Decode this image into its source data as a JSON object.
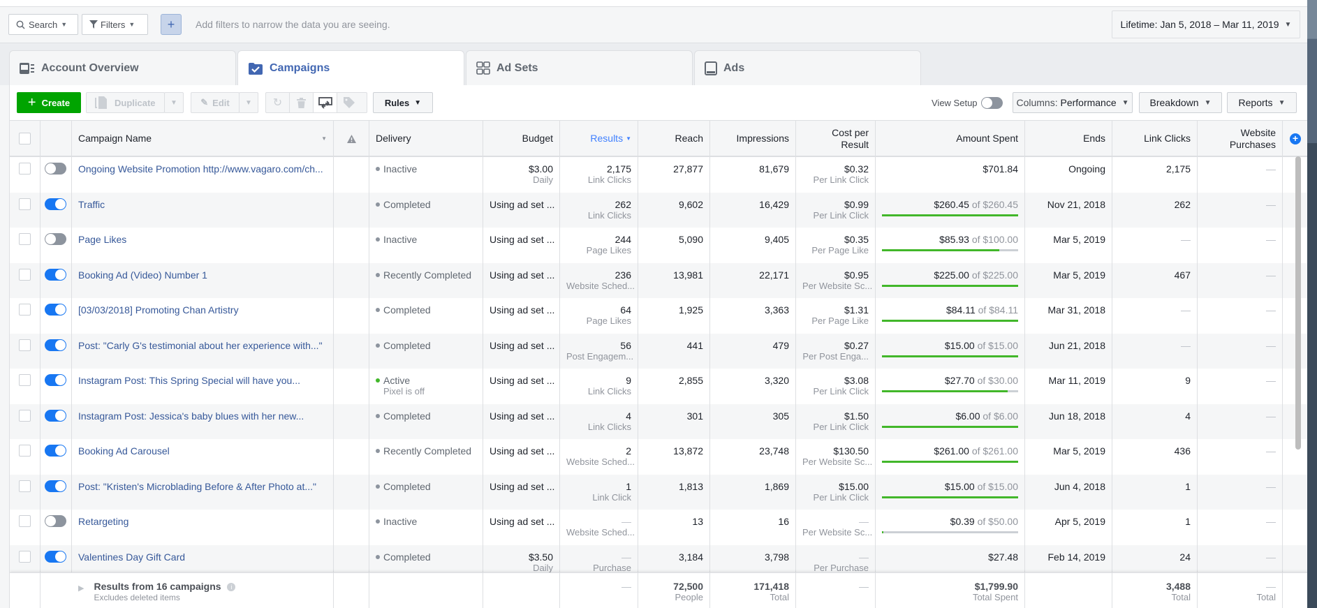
{
  "filterbar": {
    "search_label": "Search",
    "filters_label": "Filters",
    "add_filter_icon": "plus-icon",
    "hint": "Add filters to narrow the data you are seeing.",
    "date_range": "Lifetime: Jan 5, 2018 – Mar 11, 2019"
  },
  "tabs": [
    {
      "label": "Account Overview",
      "icon": "account-overview-icon",
      "active": false
    },
    {
      "label": "Campaigns",
      "icon": "campaigns-folder-check-icon",
      "active": true
    },
    {
      "label": "Ad Sets",
      "icon": "ad-sets-grid-icon",
      "active": false
    },
    {
      "label": "Ads",
      "icon": "ads-device-icon",
      "active": false
    }
  ],
  "toolbar": {
    "create_label": "Create",
    "duplicate_label": "Duplicate",
    "edit_label": "Edit",
    "rules_label": "Rules",
    "view_setup_label": "View Setup",
    "view_setup_on": false,
    "columns_prefix": "Columns:",
    "columns_value": "Performance",
    "breakdown_label": "Breakdown",
    "reports_label": "Reports"
  },
  "table": {
    "headers": {
      "name": "Campaign Name",
      "delivery": "Delivery",
      "budget": "Budget",
      "results": "Results",
      "reach": "Reach",
      "impressions": "Impressions",
      "cost_line1": "Cost per",
      "cost_line2": "Result",
      "amount": "Amount Spent",
      "ends": "Ends",
      "link_clicks": "Link Clicks",
      "purchases_line1": "Website",
      "purchases_line2": "Purchases"
    },
    "sorted_by": "Results",
    "rows": [
      {
        "on": false,
        "name": "Ongoing Website Promotion http://www.vagaro.com/ch...",
        "delivery": "Inactive",
        "delivery_sub": "",
        "delivery_color": "gray",
        "budget": "$3.00",
        "budget_sub": "Daily",
        "results": "2,175",
        "results_sub": "Link Clicks",
        "reach": "27,877",
        "impressions": "81,679",
        "cost": "$0.32",
        "cost_sub": "Per Link Click",
        "spent": "$701.84",
        "spent_of": "",
        "spent_progress": null,
        "ends": "Ongoing",
        "link_clicks": "2,175",
        "purchases": "—"
      },
      {
        "on": true,
        "name": "Traffic",
        "delivery": "Completed",
        "delivery_sub": "",
        "delivery_color": "gray",
        "budget": "Using ad set ...",
        "budget_sub": "",
        "results": "262",
        "results_sub": "Link Clicks",
        "reach": "9,602",
        "impressions": "16,429",
        "cost": "$0.99",
        "cost_sub": "Per Link Click",
        "spent": "$260.45",
        "spent_of": "of $260.45",
        "spent_progress": 1.0,
        "ends": "Nov 21, 2018",
        "link_clicks": "262",
        "purchases": "—"
      },
      {
        "on": false,
        "name": "Page Likes",
        "delivery": "Inactive",
        "delivery_sub": "",
        "delivery_color": "gray",
        "budget": "Using ad set ...",
        "budget_sub": "",
        "results": "244",
        "results_sub": "Page Likes",
        "reach": "5,090",
        "impressions": "9,405",
        "cost": "$0.35",
        "cost_sub": "Per Page Like",
        "spent": "$85.93",
        "spent_of": "of $100.00",
        "spent_progress": 0.8593,
        "ends": "Mar 5, 2019",
        "link_clicks": "—",
        "purchases": "—"
      },
      {
        "on": true,
        "name": "Booking Ad (Video) Number 1",
        "delivery": "Recently Completed",
        "delivery_sub": "",
        "delivery_color": "gray",
        "budget": "Using ad set ...",
        "budget_sub": "",
        "results": "236",
        "results_sub": "Website Sched...",
        "reach": "13,981",
        "impressions": "22,171",
        "cost": "$0.95",
        "cost_sub": "Per Website Sc...",
        "spent": "$225.00",
        "spent_of": "of $225.00",
        "spent_progress": 1.0,
        "ends": "Mar 5, 2019",
        "link_clicks": "467",
        "purchases": "—"
      },
      {
        "on": true,
        "name": "[03/03/2018] Promoting Chan Artistry",
        "delivery": "Completed",
        "delivery_sub": "",
        "delivery_color": "gray",
        "budget": "Using ad set ...",
        "budget_sub": "",
        "results": "64",
        "results_sub": "Page Likes",
        "reach": "1,925",
        "impressions": "3,363",
        "cost": "$1.31",
        "cost_sub": "Per Page Like",
        "spent": "$84.11",
        "spent_of": "of $84.11",
        "spent_progress": 1.0,
        "ends": "Mar 31, 2018",
        "link_clicks": "—",
        "purchases": "—"
      },
      {
        "on": true,
        "name": "Post: \"Carly G's testimonial about her experience with...\"",
        "delivery": "Completed",
        "delivery_sub": "",
        "delivery_color": "gray",
        "budget": "Using ad set ...",
        "budget_sub": "",
        "results": "56",
        "results_sub": "Post Engagem...",
        "reach": "441",
        "impressions": "479",
        "cost": "$0.27",
        "cost_sub": "Per Post Enga...",
        "spent": "$15.00",
        "spent_of": "of $15.00",
        "spent_progress": 1.0,
        "ends": "Jun 21, 2018",
        "link_clicks": "—",
        "purchases": "—"
      },
      {
        "on": true,
        "name": "Instagram Post: This Spring Special will have you...",
        "delivery": "Active",
        "delivery_sub": "Pixel is off",
        "delivery_color": "green",
        "budget": "Using ad set ...",
        "budget_sub": "",
        "results": "9",
        "results_sub": "Link Clicks",
        "reach": "2,855",
        "impressions": "3,320",
        "cost": "$3.08",
        "cost_sub": "Per Link Click",
        "spent": "$27.70",
        "spent_of": "of $30.00",
        "spent_progress": 0.9233,
        "ends": "Mar 11, 2019",
        "link_clicks": "9",
        "purchases": "—"
      },
      {
        "on": true,
        "name": "Instagram Post: Jessica's baby blues with her new...",
        "delivery": "Completed",
        "delivery_sub": "",
        "delivery_color": "gray",
        "budget": "Using ad set ...",
        "budget_sub": "",
        "results": "4",
        "results_sub": "Link Clicks",
        "reach": "301",
        "impressions": "305",
        "cost": "$1.50",
        "cost_sub": "Per Link Click",
        "spent": "$6.00",
        "spent_of": "of $6.00",
        "spent_progress": 1.0,
        "ends": "Jun 18, 2018",
        "link_clicks": "4",
        "purchases": "—"
      },
      {
        "on": true,
        "name": "Booking Ad Carousel",
        "delivery": "Recently Completed",
        "delivery_sub": "",
        "delivery_color": "gray",
        "budget": "Using ad set ...",
        "budget_sub": "",
        "results": "2",
        "results_sub": "Website Sched...",
        "reach": "13,872",
        "impressions": "23,748",
        "cost": "$130.50",
        "cost_sub": "Per Website Sc...",
        "spent": "$261.00",
        "spent_of": "of $261.00",
        "spent_progress": 1.0,
        "ends": "Mar 5, 2019",
        "link_clicks": "436",
        "purchases": "—"
      },
      {
        "on": true,
        "name": "Post: \"Kristen's Microblading Before & After Photo at...\"",
        "delivery": "Completed",
        "delivery_sub": "",
        "delivery_color": "gray",
        "budget": "Using ad set ...",
        "budget_sub": "",
        "results": "1",
        "results_sub": "Link Click",
        "reach": "1,813",
        "impressions": "1,869",
        "cost": "$15.00",
        "cost_sub": "Per Link Click",
        "spent": "$15.00",
        "spent_of": "of $15.00",
        "spent_progress": 1.0,
        "ends": "Jun 4, 2018",
        "link_clicks": "1",
        "purchases": "—"
      },
      {
        "on": false,
        "name": "Retargeting",
        "delivery": "Inactive",
        "delivery_sub": "",
        "delivery_color": "gray",
        "budget": "Using ad set ...",
        "budget_sub": "",
        "results": "—",
        "results_sub": "Website Sched...",
        "reach": "13",
        "impressions": "16",
        "cost": "—",
        "cost_sub": "Per Website Sc...",
        "spent": "$0.39",
        "spent_of": "of $50.00",
        "spent_progress": 0.0078,
        "ends": "Apr 5, 2019",
        "link_clicks": "1",
        "purchases": "—"
      },
      {
        "on": true,
        "name": "Valentines Day Gift Card",
        "delivery": "Completed",
        "delivery_sub": "",
        "delivery_color": "gray",
        "budget": "$3.50",
        "budget_sub": "Daily",
        "results": "—",
        "results_sub": "Purchase",
        "reach": "3,184",
        "impressions": "3,798",
        "cost": "—",
        "cost_sub": "Per Purchase",
        "spent": "$27.48",
        "spent_of": "",
        "spent_progress": null,
        "ends": "Feb 14, 2019",
        "link_clicks": "24",
        "purchases": "—"
      }
    ],
    "footer": {
      "title": "Results from 16 campaigns",
      "subtitle": "Excludes deleted items",
      "results": "—",
      "reach": "72,500",
      "reach_sub": "People",
      "impressions": "171,418",
      "impressions_sub": "Total",
      "cost": "—",
      "spent": "$1,799.90",
      "spent_sub": "Total Spent",
      "link_clicks": "3,488",
      "link_clicks_sub": "Total",
      "purchases": "—",
      "purchases_sub": "Total"
    }
  },
  "colors": {
    "accent_blue": "#4267b2",
    "link_blue": "#365899",
    "toggle_on": "#1877f2",
    "create_green": "#00a400",
    "progress_green": "#42b72a",
    "sorted_header": "#4080ff"
  }
}
